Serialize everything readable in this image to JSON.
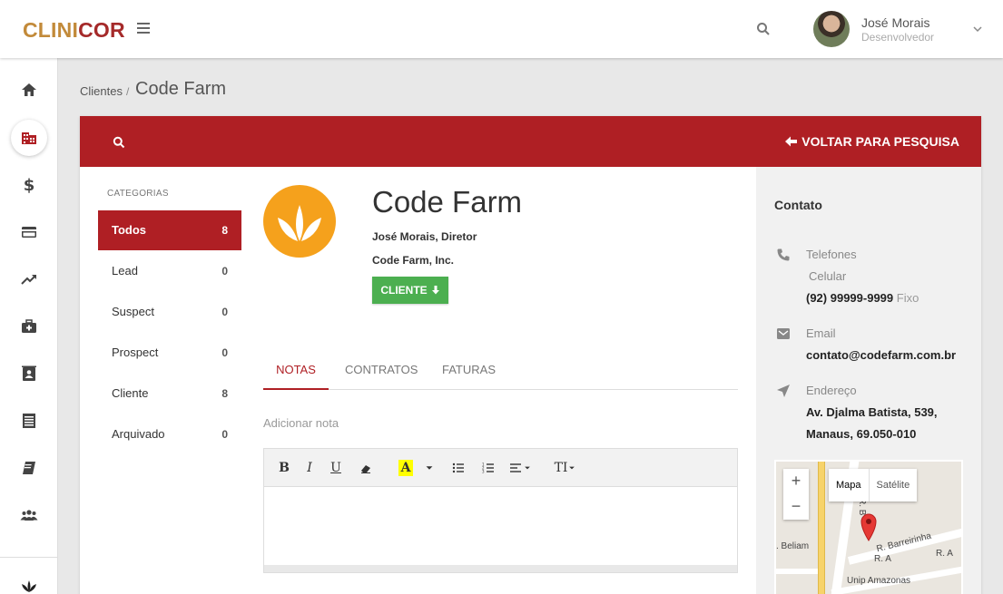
{
  "app": {
    "logo_a": "CLINI",
    "logo_b": "COR"
  },
  "user": {
    "name": "José Morais",
    "role": "Desenvolvedor"
  },
  "sidebar": {
    "items": [
      {
        "icon": "home-icon"
      },
      {
        "icon": "building-icon",
        "active": true
      },
      {
        "icon": "dollar-icon"
      },
      {
        "icon": "credit-card-icon"
      },
      {
        "icon": "trending-up-icon"
      },
      {
        "icon": "medical-kit-icon"
      },
      {
        "icon": "contact-book-icon"
      },
      {
        "icon": "receipt-icon"
      },
      {
        "icon": "book-icon"
      },
      {
        "icon": "group-icon"
      },
      {
        "icon": "leaf-logo-icon"
      }
    ]
  },
  "breadcrumb": {
    "link": "Clientes",
    "separator": "/",
    "current": "Code Farm"
  },
  "header": {
    "back_label": "VOLTAR PARA PESQUISA"
  },
  "categories": {
    "heading": "CATEGORIAS",
    "items": [
      {
        "label": "Todos",
        "count": "8",
        "active": true
      },
      {
        "label": "Lead",
        "count": "0"
      },
      {
        "label": "Suspect",
        "count": "0"
      },
      {
        "label": "Prospect",
        "count": "0"
      },
      {
        "label": "Cliente",
        "count": "8"
      },
      {
        "label": "Arquivado",
        "count": "0"
      }
    ]
  },
  "client": {
    "name": "Code Farm",
    "contact": "José Morais, Diretor",
    "company": "Code Farm, Inc.",
    "status": "CLIENTE",
    "logo_color": "#f5a11c"
  },
  "tabs": [
    {
      "label": "NOTAS",
      "active": true
    },
    {
      "label": "CONTRATOS"
    },
    {
      "label": "FATURAS"
    }
  ],
  "notes": {
    "placeholder": "Adicionar nota"
  },
  "editor": {
    "bold": "B",
    "italic": "I",
    "underline": "U",
    "color": "A",
    "text_size": "TI"
  },
  "contact": {
    "title": "Contato",
    "phone_label": "Telefones",
    "phone_type_1": "Celular",
    "phone_number": "(92) 99999-9999",
    "phone_type_2": "Fixo",
    "email_label": "Email",
    "email": "contato@codefarm.com.br",
    "address_label": "Endereço",
    "address_line1": "Av. Djalma Batista, 539,",
    "address_line2": "Manaus, 69.050-010"
  },
  "map": {
    "zoom_in": "+",
    "zoom_out": "−",
    "type_map": "Mapa",
    "type_satellite": "Satélite",
    "street_1": "R. Barreirinha",
    "street_2": "R. A",
    "street_3": "R. A",
    "street_4": ". Beliam",
    "place": "Unip Amazonas",
    "street_vertical": "R. B"
  },
  "colors": {
    "brand_red": "#af1f24",
    "logo_gold": "#c28a3a",
    "success": "#4caf50"
  }
}
